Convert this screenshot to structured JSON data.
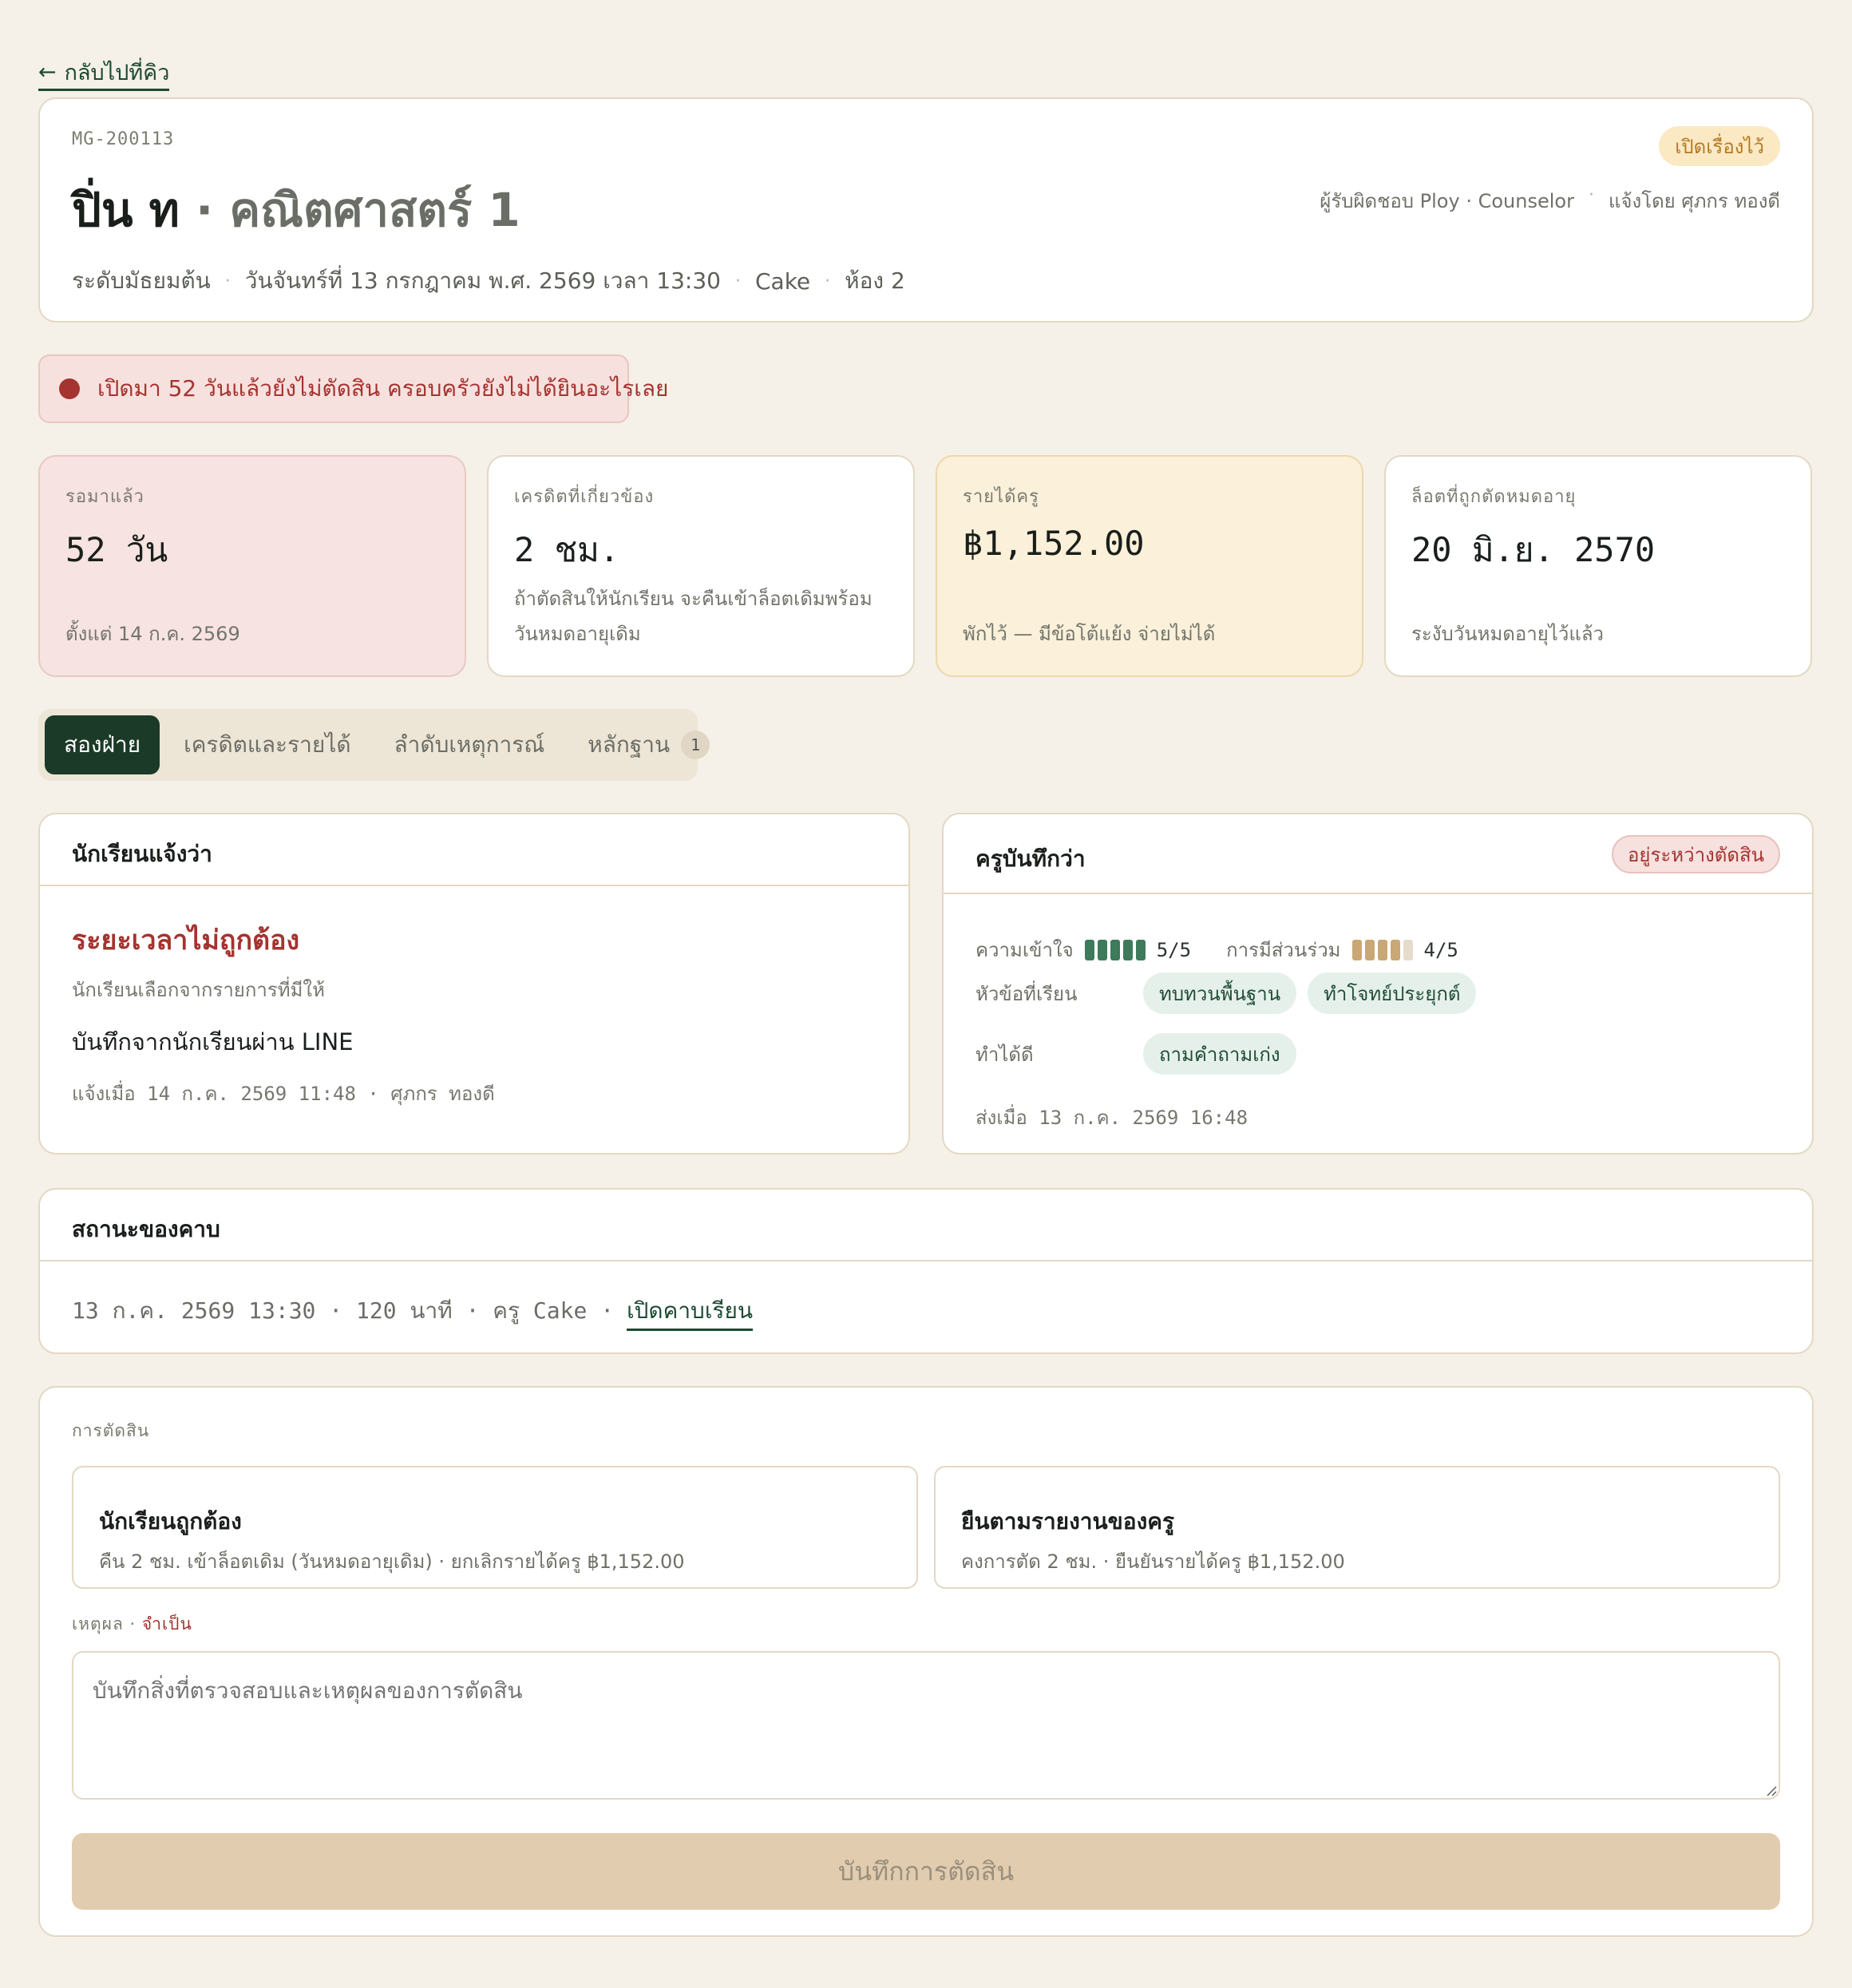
{
  "back_link": {
    "arrow": "←",
    "label": "กลับไปที่คิว"
  },
  "header": {
    "case_id": "MG-200113",
    "student": "ปิ่น ท",
    "separator": "·",
    "subject": "คณิตศาสตร์ 1",
    "status": "เปิดเรื่องไว้",
    "owner": "ผู้รับผิดชอบ Ploy · Counselor",
    "reported_by": "แจ้งโดย ศุภกร ทองดี",
    "meta": [
      "ระดับมัธยมต้น",
      "วันจันทร์ที่ 13 กรกฎาคม พ.ศ. 2569 เวลา 13:30",
      "Cake",
      "ห้อง 2"
    ]
  },
  "alert": {
    "text": "เปิดมา 52 วันแล้วยังไม่ตัดสิน ครอบครัวยังไม่ได้ยินอะไรเลย",
    "color": "#a5332f"
  },
  "stats": [
    {
      "label": "รอมาแล้ว",
      "value": "52 วัน",
      "note": "ตั้งแต่ 14 ก.ค. 2569"
    },
    {
      "label": "เครดิตที่เกี่ยวข้อง",
      "value": "2 ชม.",
      "note": "ถ้าตัดสินให้นักเรียน จะคืนเข้าล็อตเดิมพร้อมวันหมดอายุเดิม"
    },
    {
      "label": "รายได้ครู",
      "value": "฿1,152.00",
      "note": "พักไว้ — มีข้อโต้แย้ง จ่ายไม่ได้"
    },
    {
      "label": "ล็อตที่ถูกตัดหมดอายุ",
      "value": "20 มิ.ย. 2570",
      "note": "ระงับวันหมดอายุไว้แล้ว"
    }
  ],
  "tabs": [
    {
      "label": "สองฝ่าย"
    },
    {
      "label": "เครดิตและรายได้"
    },
    {
      "label": "ลำดับเหตุการณ์"
    },
    {
      "label": "หลักฐาน",
      "count": "1"
    }
  ],
  "student_panel": {
    "title": "นักเรียนแจ้งว่า",
    "issue": "ระยะเวลาไม่ถูกต้อง",
    "issue_source": "นักเรียนเลือกจากรายการที่มีให้",
    "note": "บันทึกจากนักเรียนผ่าน LINE",
    "reported_at": "แจ้งเมื่อ 14 ก.ค. 2569 11:48 · ศุภกร ทองดี"
  },
  "teacher_panel": {
    "title": "ครูบันทึกว่า",
    "status": "อยู่ระหว่างตัดสิน",
    "understanding_label": "ความเข้าใจ",
    "understanding_score": 5,
    "understanding_text": "5/5",
    "participation_label": "การมีส่วนร่วม",
    "participation_score": 4,
    "participation_text": "4/5",
    "topics_label": "หัวข้อที่เรียน",
    "topics": [
      "ทบทวนพื้นฐาน",
      "ทำโจทย์ประยุกต์"
    ],
    "strengths_label": "ทำได้ดี",
    "strengths": [
      "ถามคำถามเก่ง"
    ],
    "sent_at": "ส่งเมื่อ 13 ก.ค. 2569 16:48"
  },
  "session": {
    "title": "สถานะของคาบ",
    "details": "13 ก.ค. 2569 13:30 · 120 นาที · ครู Cake ·",
    "link": "เปิดคาบเรียน"
  },
  "decision": {
    "label": "การตัดสิน",
    "options": [
      {
        "title": "นักเรียนถูกต้อง",
        "desc": "คืน 2 ชม. เข้าล็อตเดิม (วันหมดอายุเดิม) · ยกเลิกรายได้ครู ฿1,152.00"
      },
      {
        "title": "ยืนตามรายงานของครู",
        "desc": "คงการตัด 2 ชม. · ยืนยันรายได้ครู ฿1,152.00"
      }
    ],
    "reason_label": "เหตุผล",
    "reason_sep": "·",
    "reason_required": "จำเป็น",
    "reason_placeholder": "บันทึกสิ่งที่ตรวจสอบและเหตุผลของการตัดสิน",
    "submit": "บันทึกการตัดสิน"
  },
  "colors": {
    "accent": "#1b3a28",
    "danger": "#a5332f",
    "warning": "#b37a22",
    "background": "#f5f0e8"
  }
}
